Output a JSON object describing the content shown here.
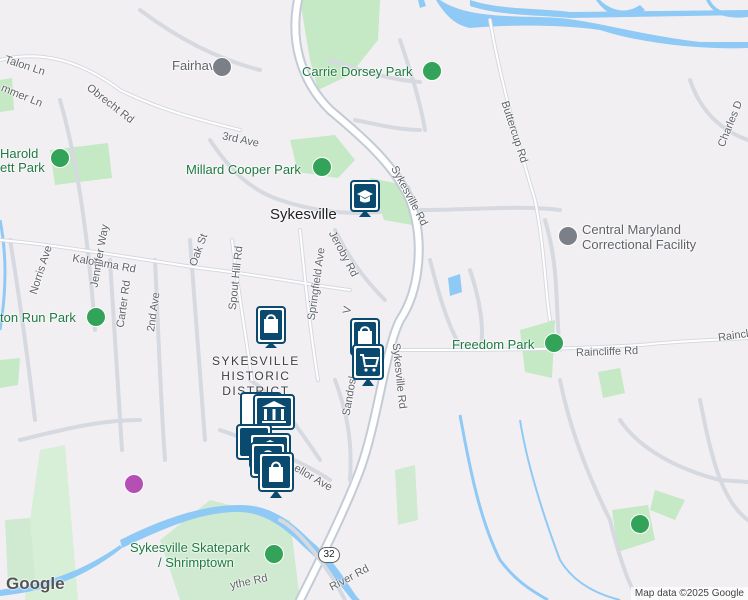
{
  "map": {
    "town_label": "Sykesville",
    "district_label": "SYKESVILLE HISTORIC DISTRICT",
    "district_lines": [
      "SYKESVILLE",
      "HISTORIC",
      "DISTRICT"
    ],
    "road_labels": {
      "talon": "Talon Ln",
      "mmer": "mmer Ln",
      "obrecht": "Obrecht Rd",
      "third_ave": "3rd Ave",
      "buttercup": "Buttercup Rd",
      "charles": "Charles D",
      "sykesville_rd_north": "Sykesville Rd",
      "sykesville_rd_south": "Sykesville Rd",
      "jeroby": "Jeroby Rd",
      "springfield": "Springfield Ave",
      "spout_hill": "Spout Hill Rd",
      "oak": "Oak St",
      "kalorama": "Kalorama Rd",
      "jennifer": "Jennifer Way",
      "norris": "Norris Ave",
      "carter": "Carter Rd",
      "second_ave": "2nd Ave",
      "sandos": "Sandosl",
      "v_partial": "V",
      "raincliffe": "Raincliffe Rd",
      "raincliffe_east": "Raincl",
      "ellor": "ellor Ave",
      "river": "River Rd",
      "forsythe": "ythe Rd"
    },
    "poi_labels": {
      "fairhaven": "Fairhaven",
      "carrie_dorsey": "Carrie Dorsey Park",
      "harold": "Harold",
      "harold_2": "ett Park",
      "millard": "Millard Cooper Park",
      "central_md_1": "Central Maryland",
      "central_md_2": "Correctional Facility",
      "freedom_park": "Freedom Park",
      "piney_run": "ton Run Park",
      "skatepark_1": "Sykesville Skatepark",
      "skatepark_2": "/ Shrimptown"
    },
    "route_shield": "32",
    "google_logo": "Google",
    "attribution": "Map data ©2025 Google",
    "colors": {
      "background": "#f2eff3",
      "park_green": "#c5e8c5",
      "water": "#8fc9f5",
      "road": "#ffffff",
      "major_road": "#c2cbd6",
      "pin_blue": "#0b4a6f",
      "park_icon": "#33a35a"
    },
    "pins": [
      {
        "icon": "school-icon",
        "kind": "school"
      },
      {
        "icon": "shopping-bag-icon",
        "kind": "store"
      },
      {
        "icon": "shopping-bag-icon",
        "kind": "store"
      },
      {
        "icon": "shopping-cart-icon",
        "kind": "grocery"
      },
      {
        "icon": "bank-icon",
        "kind": "bank"
      },
      {
        "icon": "bank-icon",
        "kind": "bank"
      },
      {
        "icon": "shopping-bag-icon",
        "kind": "store"
      },
      {
        "icon": "shopping-bag-icon",
        "kind": "store"
      }
    ]
  }
}
